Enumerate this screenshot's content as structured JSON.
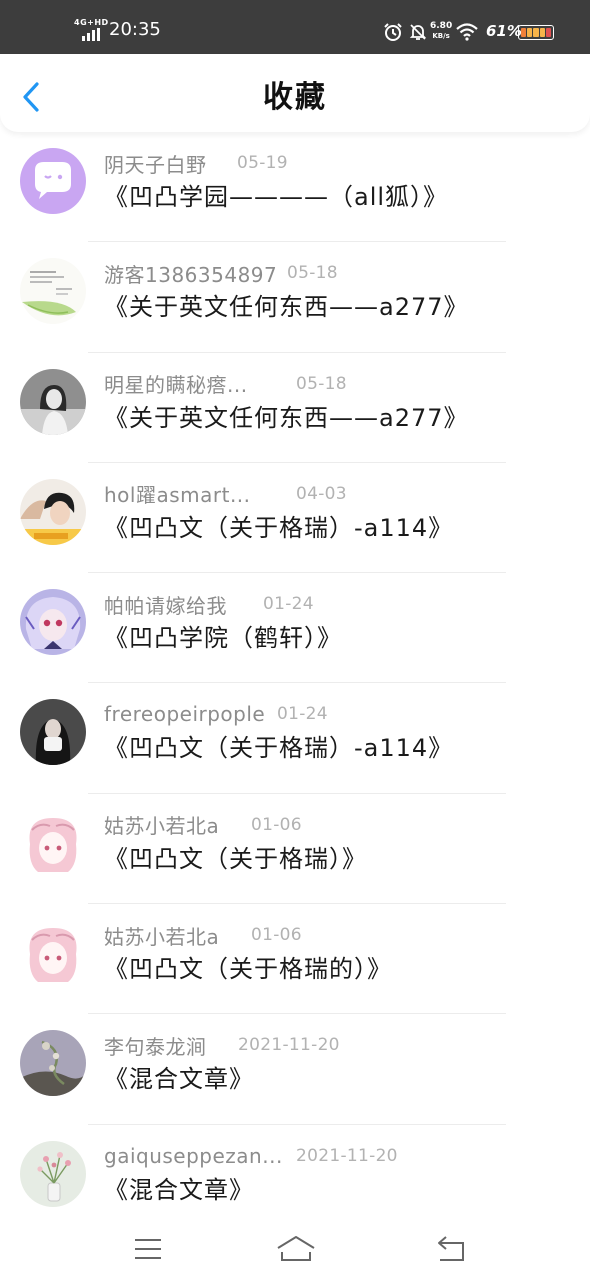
{
  "status_bar": {
    "network": "4G+HD",
    "time": "20:35",
    "speed_value": "6.80",
    "speed_unit": "KB/s",
    "battery_text": "61%",
    "icons": [
      "signal-icon",
      "alarm-icon",
      "dnd-icon",
      "wifi-icon",
      "battery-icon"
    ]
  },
  "header": {
    "title": "收藏",
    "back_icon": "chevron-left-icon",
    "accent_color": "#2196f3"
  },
  "items": [
    {
      "author": "阴天子白野",
      "date": "05-19",
      "title": "《凹凸学园————（all狐）》"
    },
    {
      "author": "游客1386354897",
      "date": "05-18",
      "title": "《关于英文任何东西——a277》"
    },
    {
      "author": "明星的瞒秘瘩...",
      "date": "05-18",
      "title": "《关于英文任何东西——a277》"
    },
    {
      "author": "hol躍asmart...",
      "date": "04-03",
      "title": "《凹凸文（关于格瑞）-a114》"
    },
    {
      "author": "帕帕请嫁给我",
      "date": "01-24",
      "title": "《凹凸学院（鹤轩）》"
    },
    {
      "author": "frereopeirpople",
      "date": "01-24",
      "title": "《凹凸文（关于格瑞）-a114》"
    },
    {
      "author": "姑苏小若北a",
      "date": "01-06",
      "title": "《凹凸文（关于格瑞）》"
    },
    {
      "author": "姑苏小若北a",
      "date": "01-06",
      "title": "《凹凸文（关于格瑞的）》"
    },
    {
      "author": "李句泰龙涧",
      "date": "2021-11-20",
      "title": "《混合文章》"
    },
    {
      "author": "gaiquseppezan...",
      "date": "2021-11-20",
      "title": "《混合文章》"
    }
  ],
  "nav_bar": {
    "icons": [
      "menu-icon",
      "home-icon",
      "back-icon"
    ]
  }
}
